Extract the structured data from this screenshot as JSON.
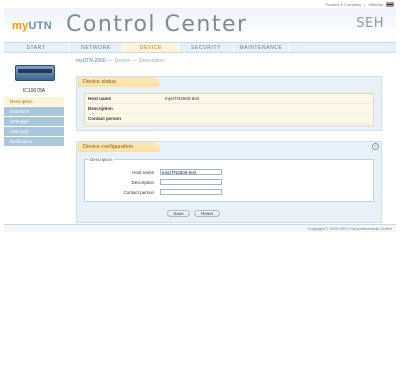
{
  "toplinks": {
    "product": "Product & Company",
    "separator": "|",
    "sitemap": "Sitemap"
  },
  "header": {
    "logo_my": "my",
    "logo_utn": "UTN",
    "title": "Control Center",
    "brand": "SEH"
  },
  "nav": {
    "items": [
      {
        "label": "START"
      },
      {
        "label": "NETWORK"
      },
      {
        "label": "DEVICE"
      },
      {
        "label": "SECURITY"
      },
      {
        "label": "MAINTENANCE"
      }
    ]
  },
  "sidebar": {
    "device_name": "IC10678A",
    "items": [
      {
        "label": "Description"
      },
      {
        "label": "Date/time"
      },
      {
        "label": "UTN port"
      },
      {
        "label": "USB port"
      },
      {
        "label": "Notification"
      }
    ]
  },
  "breadcrumb": {
    "device": "myUTN-2500",
    "sep1": "—",
    "section": "Device",
    "sep2": "—",
    "page": "Description"
  },
  "status_panel": {
    "title": "Device status",
    "rows": [
      {
        "label": "Host name",
        "value": "myUTN2500-test"
      },
      {
        "label": "Description",
        "value": ""
      },
      {
        "label": "Contact person",
        "value": ""
      }
    ]
  },
  "config_panel": {
    "title": "Device configuration",
    "help": "?",
    "legend": "Description",
    "fields": [
      {
        "label": "Host name",
        "value": "myUTN2500-test"
      },
      {
        "label": "Description",
        "value": ""
      },
      {
        "label": "Contact person",
        "value": ""
      }
    ],
    "save_label": "Save",
    "reset_label": "Reset"
  },
  "footer": {
    "copyright": "Copyright © 2018 SEH Computertechnik GmbH"
  }
}
